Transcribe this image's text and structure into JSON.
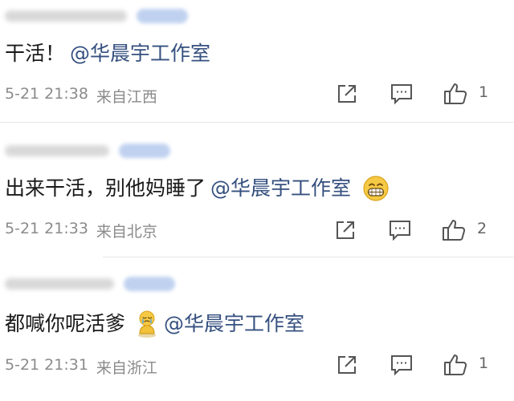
{
  "comments": [
    {
      "text": "干活！",
      "mention": "@华晨宇工作室",
      "time": "5-21 21:38",
      "location": "来自江西",
      "likes": "1",
      "emoji": ""
    },
    {
      "text": "出来干活，别他妈睡了",
      "mention": "@华晨宇工作室",
      "time": "5-21 21:33",
      "location": "来自北京",
      "likes": "2",
      "emoji": "grinning-face"
    },
    {
      "text": "都喊你呢活爹",
      "mention": "@华晨宇工作室",
      "time": "5-21 21:31",
      "location": "来自浙江",
      "likes": "1",
      "emoji": "crying-sitting-figure"
    }
  ],
  "icons": {
    "share": "share-icon",
    "comment": "comment-icon",
    "like": "thumbs-up-icon"
  },
  "colors": {
    "mention": "#35507f",
    "meta": "#8b8b8b",
    "icon": "#555555"
  }
}
